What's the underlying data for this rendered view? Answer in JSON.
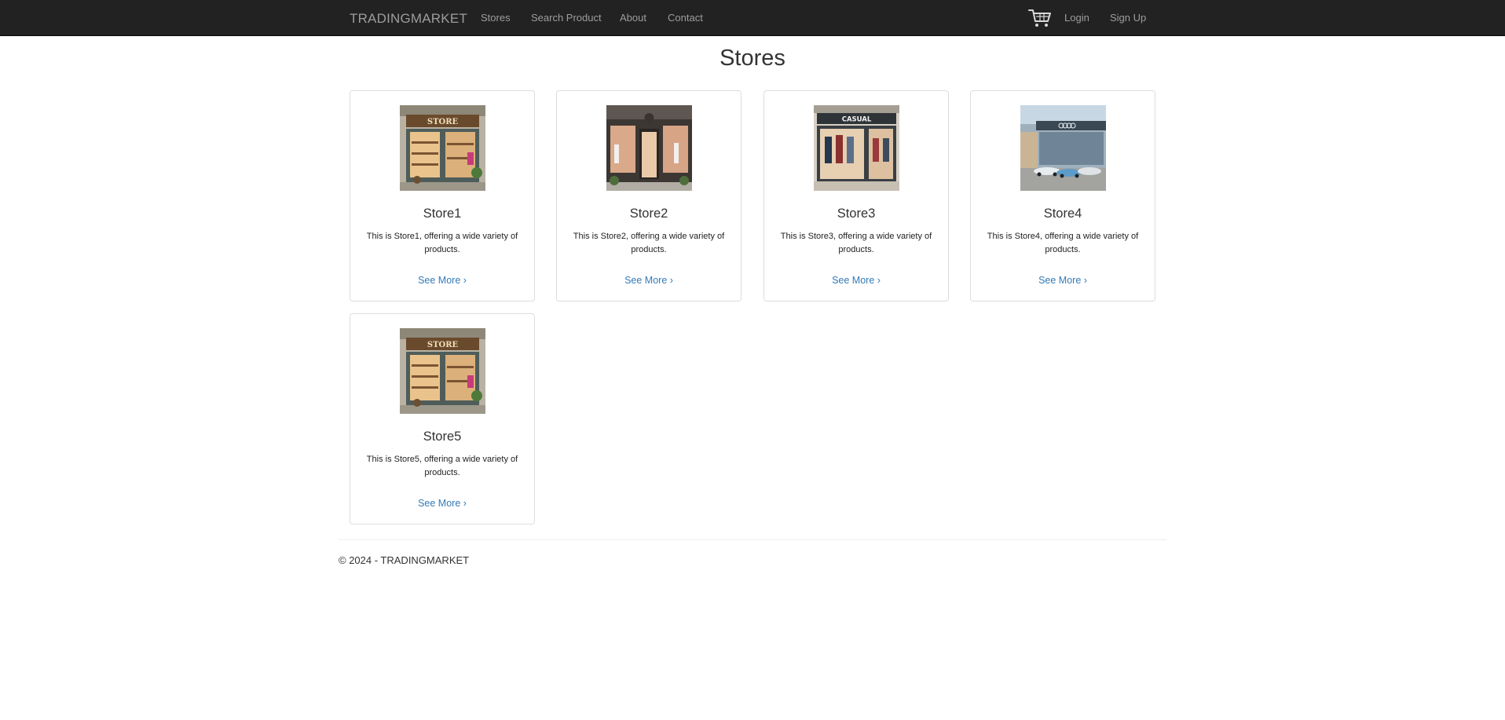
{
  "navbar": {
    "brand": "TRADINGMARKET",
    "links": [
      "Stores",
      "Search Product",
      "About",
      "Contact"
    ],
    "login": "Login",
    "signup": "Sign Up"
  },
  "page": {
    "title": "Stores"
  },
  "stores": [
    {
      "name": "Store1",
      "description": "This is Store1, offering a wide variety of products.",
      "link": "See More ›",
      "image": "storefront-sign"
    },
    {
      "name": "Store2",
      "description": "This is Store2, offering a wide variety of products.",
      "link": "See More ›",
      "image": "boutique-corner"
    },
    {
      "name": "Store3",
      "description": "This is Store3, offering a wide variety of products.",
      "link": "See More ›",
      "image": "clothing-casual",
      "sign": "CASUAL"
    },
    {
      "name": "Store4",
      "description": "This is Store4, offering a wide variety of products.",
      "link": "See More ›",
      "image": "car-dealership"
    },
    {
      "name": "Store5",
      "description": "This is Store5, offering a wide variety of products.",
      "link": "See More ›",
      "image": "storefront-sign"
    }
  ],
  "image_sign": "STORE",
  "footer": {
    "text": "© 2024 - TRADINGMARKET"
  },
  "colors": {
    "navbar": "#222222",
    "nav_text": "#9d9d9d",
    "link": "#337ab7",
    "border": "#dddddd"
  }
}
